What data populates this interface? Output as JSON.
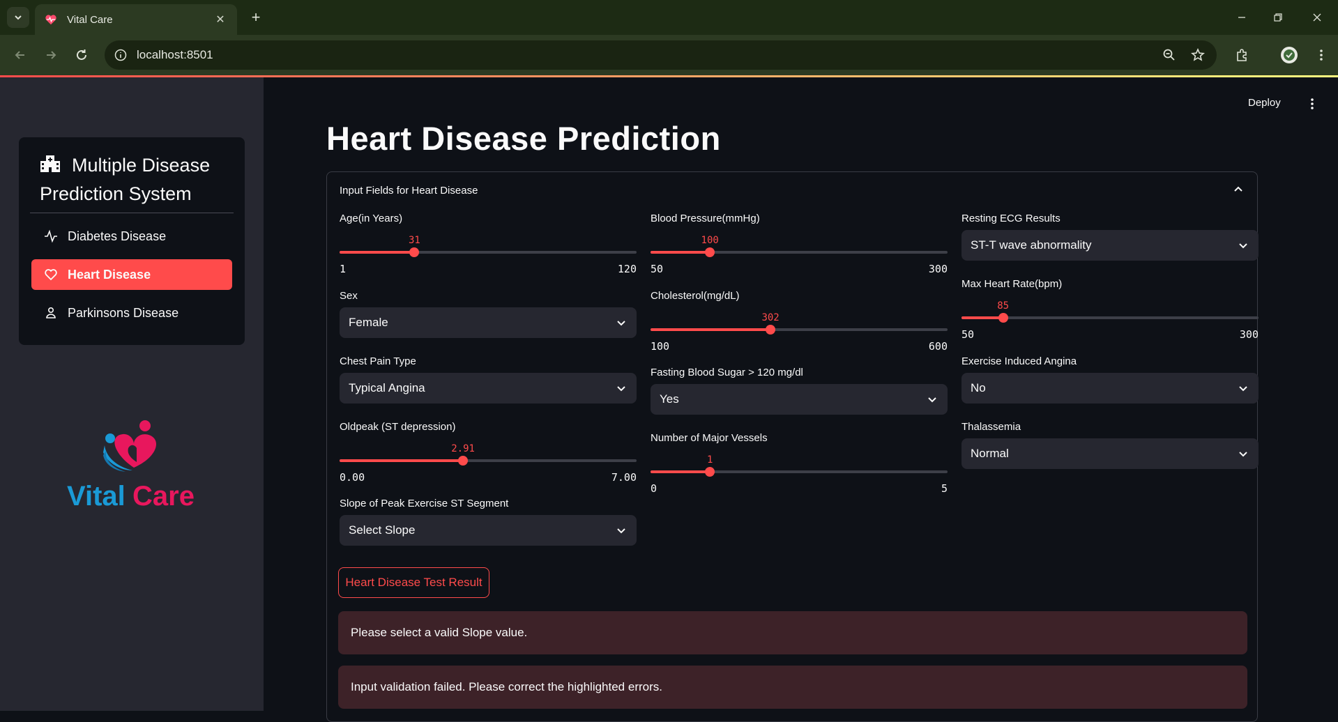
{
  "browser": {
    "tab_title": "Vital Care",
    "url": "localhost:8501"
  },
  "app": {
    "deploy_label": "Deploy"
  },
  "sidebar": {
    "title_line1": "Multiple Disease",
    "title_line2": "Prediction System",
    "items": [
      {
        "label": "Diabetes Disease",
        "icon": "activity-icon",
        "active": false
      },
      {
        "label": "Heart Disease",
        "icon": "heart-icon",
        "active": true
      },
      {
        "label": "Parkinsons Disease",
        "icon": "person-icon",
        "active": false
      }
    ],
    "logo_text_1": "Vital",
    "logo_text_2": "Care",
    "logo_colors": {
      "blue": "#1a9ad6",
      "pink": "#e8175d"
    }
  },
  "main": {
    "title": "Heart Disease Prediction",
    "expander_label": "Input Fields for Heart Disease",
    "fields": {
      "age": {
        "label": "Age(in Years)",
        "value": 31,
        "min": 1,
        "max": 120,
        "value_text": "31",
        "min_text": "1",
        "max_text": "120"
      },
      "sex": {
        "label": "Sex",
        "value": "Female"
      },
      "chest_pain": {
        "label": "Chest Pain Type",
        "value": "Typical Angina"
      },
      "oldpeak": {
        "label": "Oldpeak (ST depression)",
        "value": 2.91,
        "min": 0,
        "max": 7,
        "value_text": "2.91",
        "min_text": "0.00",
        "max_text": "7.00"
      },
      "slope": {
        "label": "Slope of Peak Exercise ST Segment",
        "value": "Select Slope"
      },
      "blood_pressure": {
        "label": "Blood Pressure(mmHg)",
        "value": 100,
        "min": 50,
        "max": 300,
        "value_text": "100",
        "min_text": "50",
        "max_text": "300"
      },
      "cholesterol": {
        "label": "Cholesterol(mg/dL)",
        "value": 302,
        "min": 100,
        "max": 600,
        "value_text": "302",
        "min_text": "100",
        "max_text": "600"
      },
      "fasting_blood_sugar": {
        "label": "Fasting Blood Sugar > 120 mg/dl",
        "value": "Yes"
      },
      "major_vessels": {
        "label": "Number of Major Vessels",
        "value": 1,
        "min": 0,
        "max": 5,
        "value_text": "1",
        "min_text": "0",
        "max_text": "5"
      },
      "resting_ecg": {
        "label": "Resting ECG Results",
        "value": "ST-T wave abnormality"
      },
      "max_heart_rate": {
        "label": "Max Heart Rate(bpm)",
        "value": 85,
        "min": 50,
        "max": 300,
        "value_text": "85",
        "min_text": "50",
        "max_text": "300"
      },
      "exercise_angina": {
        "label": "Exercise Induced Angina",
        "value": "No"
      },
      "thalassemia": {
        "label": "Thalassemia",
        "value": "Normal"
      }
    },
    "button_label": "Heart Disease Test Result",
    "alerts": [
      "Please select a valid Slope value.",
      "Input validation failed. Please correct the highlighted errors."
    ]
  },
  "colors": {
    "accent": "#ff4b4b",
    "background": "#0e1117",
    "sidebar": "#262730",
    "alert_bg": "#3d2228"
  }
}
